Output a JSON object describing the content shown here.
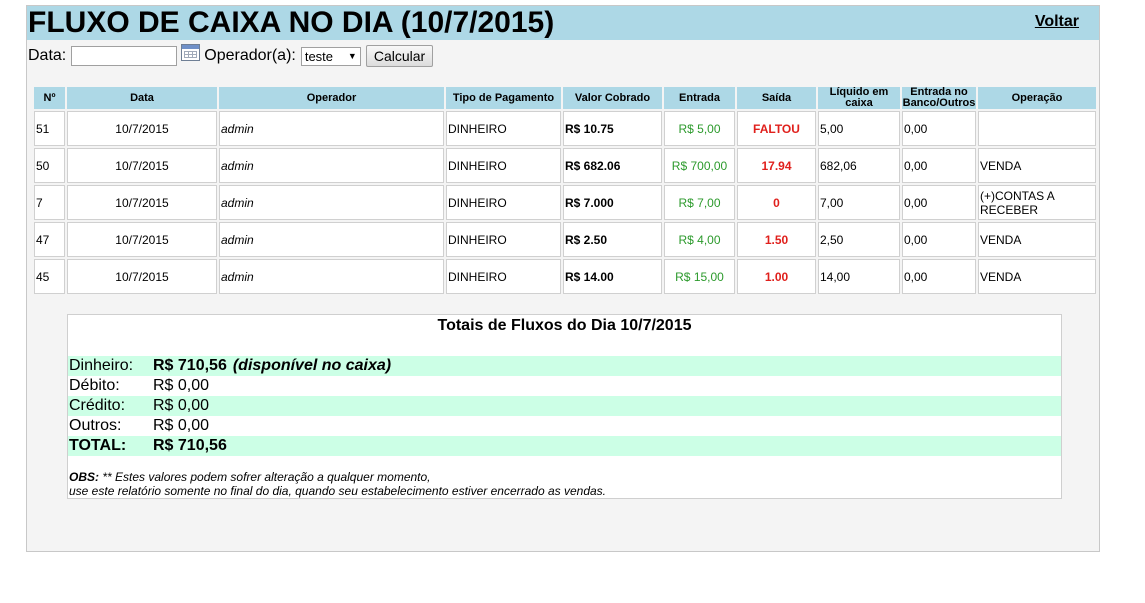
{
  "header": {
    "title": "FLUXO DE CAIXA NO DIA (10/7/2015)",
    "back_label": "Voltar",
    "header_color": "#add8e6"
  },
  "filters": {
    "date_label": "Data:",
    "date_value": "",
    "calendar_icon": "calendar-icon",
    "operator_label": "Operador(a):",
    "operator_selected": "teste",
    "calculate_label": "Calcular"
  },
  "table": {
    "columns": [
      "Nº",
      "Data",
      "Operador",
      "Tipo de Pagamento",
      "Valor Cobrado",
      "Entrada",
      "Saída",
      "Líquido em caixa",
      "Entrada no Banco/Outros",
      "Operação"
    ],
    "rows": [
      {
        "n": "51",
        "data": "10/7/2015",
        "operador": "admin",
        "tipo": "DINHEIRO",
        "valor": "R$ 10.75",
        "entrada": "R$ 5,00",
        "saida": "FALTOU",
        "liquido": "5,00",
        "banco": "0,00",
        "operacao": ""
      },
      {
        "n": "50",
        "data": "10/7/2015",
        "operador": "admin",
        "tipo": "DINHEIRO",
        "valor": "R$ 682.06",
        "entrada": "R$ 700,00",
        "saida": "17.94",
        "liquido": "682,06",
        "banco": "0,00",
        "operacao": "VENDA"
      },
      {
        "n": "7",
        "data": "10/7/2015",
        "operador": "admin",
        "tipo": "DINHEIRO",
        "valor": "R$ 7.000",
        "entrada": "R$ 7,00",
        "saida": "0",
        "liquido": "7,00",
        "banco": "0,00",
        "operacao": "(+)CONTAS A RECEBER"
      },
      {
        "n": "47",
        "data": "10/7/2015",
        "operador": "admin",
        "tipo": "DINHEIRO",
        "valor": "R$ 2.50",
        "entrada": "R$ 4,00",
        "saida": "1.50",
        "liquido": "2,50",
        "banco": "0,00",
        "operacao": "VENDA"
      },
      {
        "n": "45",
        "data": "10/7/2015",
        "operador": "admin",
        "tipo": "DINHEIRO",
        "valor": "R$ 14.00",
        "entrada": "R$ 15,00",
        "saida": "1.00",
        "liquido": "14,00",
        "banco": "0,00",
        "operacao": "VENDA"
      }
    ]
  },
  "totals": {
    "title": "Totais de Fluxos do Dia 10/7/2015",
    "dinheiro_label": "Dinheiro:",
    "dinheiro_value": "R$ 710,56",
    "dinheiro_note": "(disponível no caixa)",
    "debito_label": "Débito:",
    "debito_value": "R$ 0,00",
    "credito_label": "Crédito:",
    "credito_value": "R$ 0,00",
    "outros_label": "Outros:",
    "outros_value": "R$ 0,00",
    "total_label": "TOTAL:",
    "total_value": "R$ 710,56",
    "obs_label": "OBS:",
    "obs_line1": "** Estes valores podem sofrer alteração a qualquer momento,",
    "obs_line2": "use este relatório somente no final do dia, quando seu estabelecimento estiver encerrado as vendas.",
    "highlight_color": "#ccffe6"
  },
  "colors": {
    "green": "#2c9a2c",
    "red": "#e0201c"
  }
}
